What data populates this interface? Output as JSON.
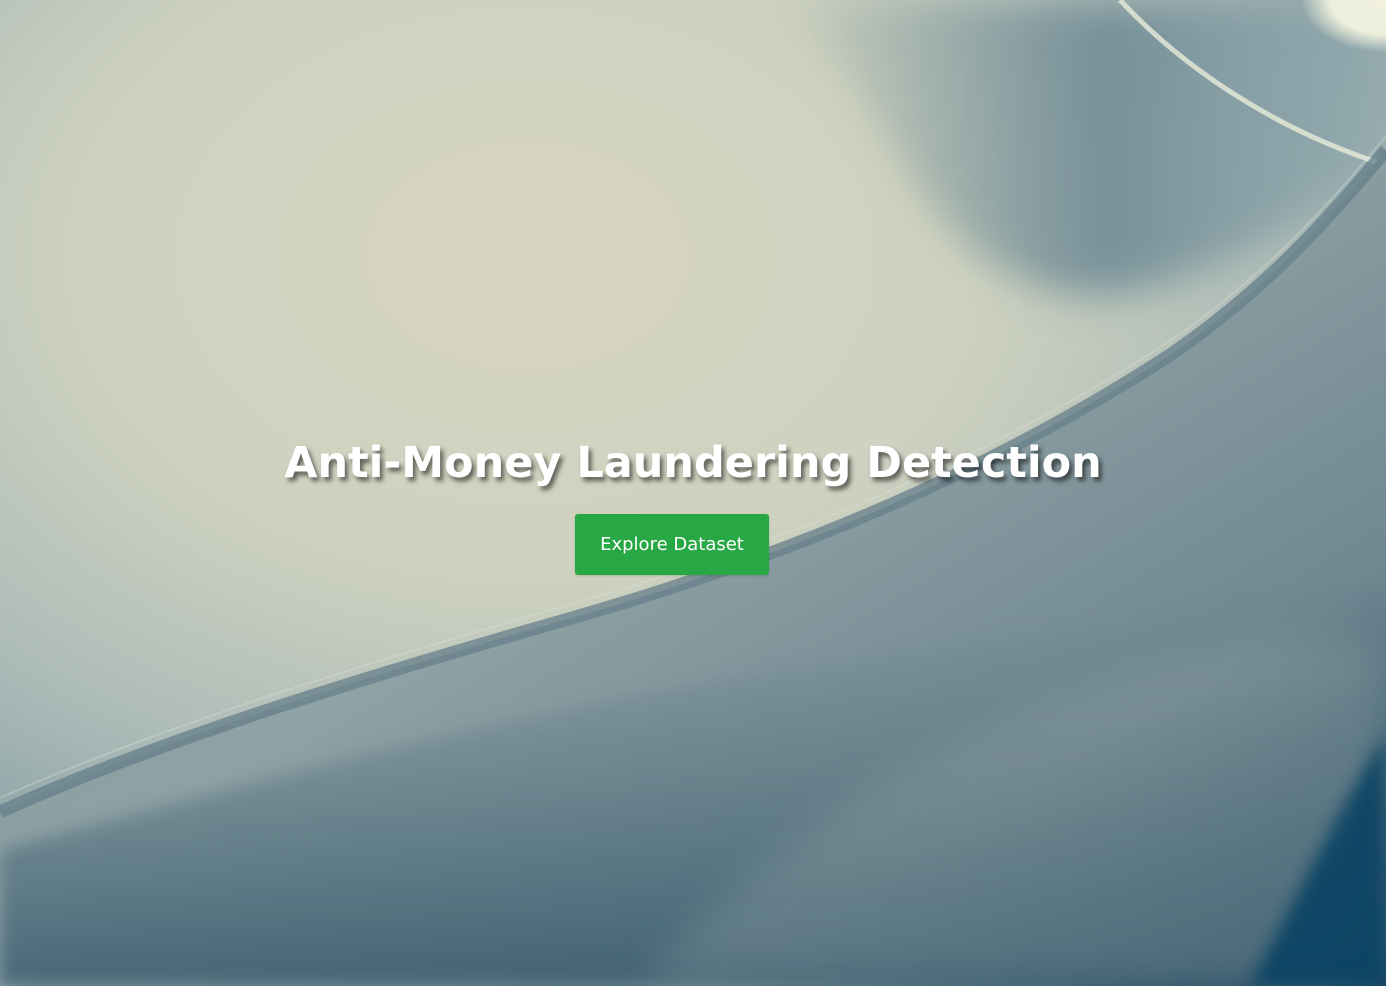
{
  "hero": {
    "title": "Anti-Money Laundering Detection",
    "button_label": "Explore Dataset",
    "background": "abstract-curved-architecture-image"
  },
  "colors": {
    "button": "#28a745",
    "title_text": "#ffffff",
    "background_light": "#d3d4bf",
    "background_dark": "#0b3d5c"
  }
}
